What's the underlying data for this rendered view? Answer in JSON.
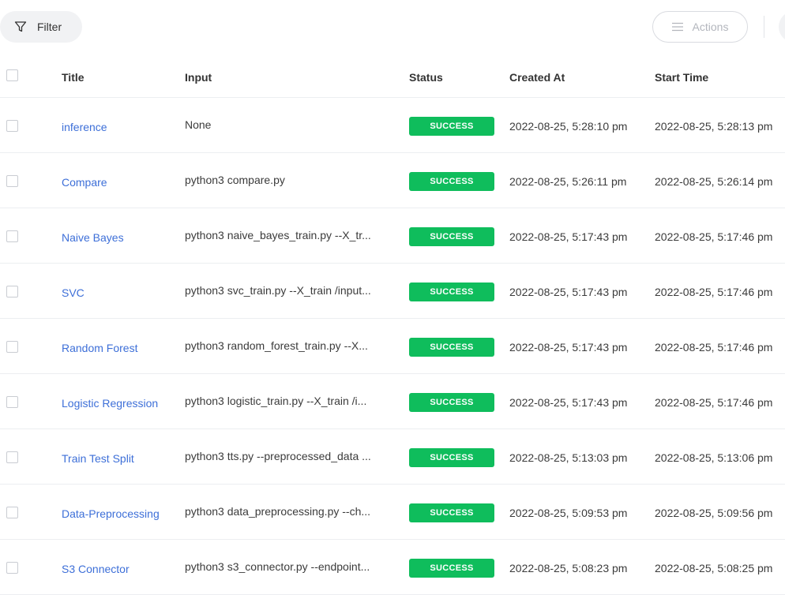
{
  "toolbar": {
    "filter_label": "Filter",
    "filter_icon": "filter-funnel-icon",
    "actions_label": "Actions",
    "actions_icon": "hamburger-menu-icon"
  },
  "table": {
    "columns": [
      "Title",
      "Input",
      "Status",
      "Created At",
      "Start Time"
    ],
    "rows": [
      {
        "title": "inference",
        "input": "None",
        "status": "SUCCESS",
        "created_at": "2022-08-25, 5:28:10 pm",
        "start_time": "2022-08-25, 5:28:13 pm"
      },
      {
        "title": "Compare",
        "input": "python3 compare.py",
        "status": "SUCCESS",
        "created_at": "2022-08-25, 5:26:11 pm",
        "start_time": "2022-08-25, 5:26:14 pm"
      },
      {
        "title": "Naive Bayes",
        "input": "python3 naive_bayes_train.py --X_tr...",
        "status": "SUCCESS",
        "created_at": "2022-08-25, 5:17:43 pm",
        "start_time": "2022-08-25, 5:17:46 pm"
      },
      {
        "title": "SVC",
        "input": "python3 svc_train.py --X_train /input...",
        "status": "SUCCESS",
        "created_at": "2022-08-25, 5:17:43 pm",
        "start_time": "2022-08-25, 5:17:46 pm"
      },
      {
        "title": "Random Forest",
        "input": "python3 random_forest_train.py --X...",
        "status": "SUCCESS",
        "created_at": "2022-08-25, 5:17:43 pm",
        "start_time": "2022-08-25, 5:17:46 pm"
      },
      {
        "title": "Logistic Regression",
        "input": "python3 logistic_train.py --X_train /i...",
        "status": "SUCCESS",
        "created_at": "2022-08-25, 5:17:43 pm",
        "start_time": "2022-08-25, 5:17:46 pm"
      },
      {
        "title": "Train Test Split",
        "input": "python3 tts.py --preprocessed_data ...",
        "status": "SUCCESS",
        "created_at": "2022-08-25, 5:13:03 pm",
        "start_time": "2022-08-25, 5:13:06 pm"
      },
      {
        "title": "Data-Preprocessing",
        "input": "python3 data_preprocessing.py --ch...",
        "status": "SUCCESS",
        "created_at": "2022-08-25, 5:09:53 pm",
        "start_time": "2022-08-25, 5:09:56 pm"
      },
      {
        "title": "S3 Connector",
        "input": "python3 s3_connector.py --endpoint...",
        "status": "SUCCESS",
        "created_at": "2022-08-25, 5:08:23 pm",
        "start_time": "2022-08-25, 5:08:25 pm"
      }
    ]
  },
  "colors": {
    "link": "#3d6fd8",
    "success_badge": "#0fbd5c",
    "filter_bg": "#f1f2f4"
  }
}
